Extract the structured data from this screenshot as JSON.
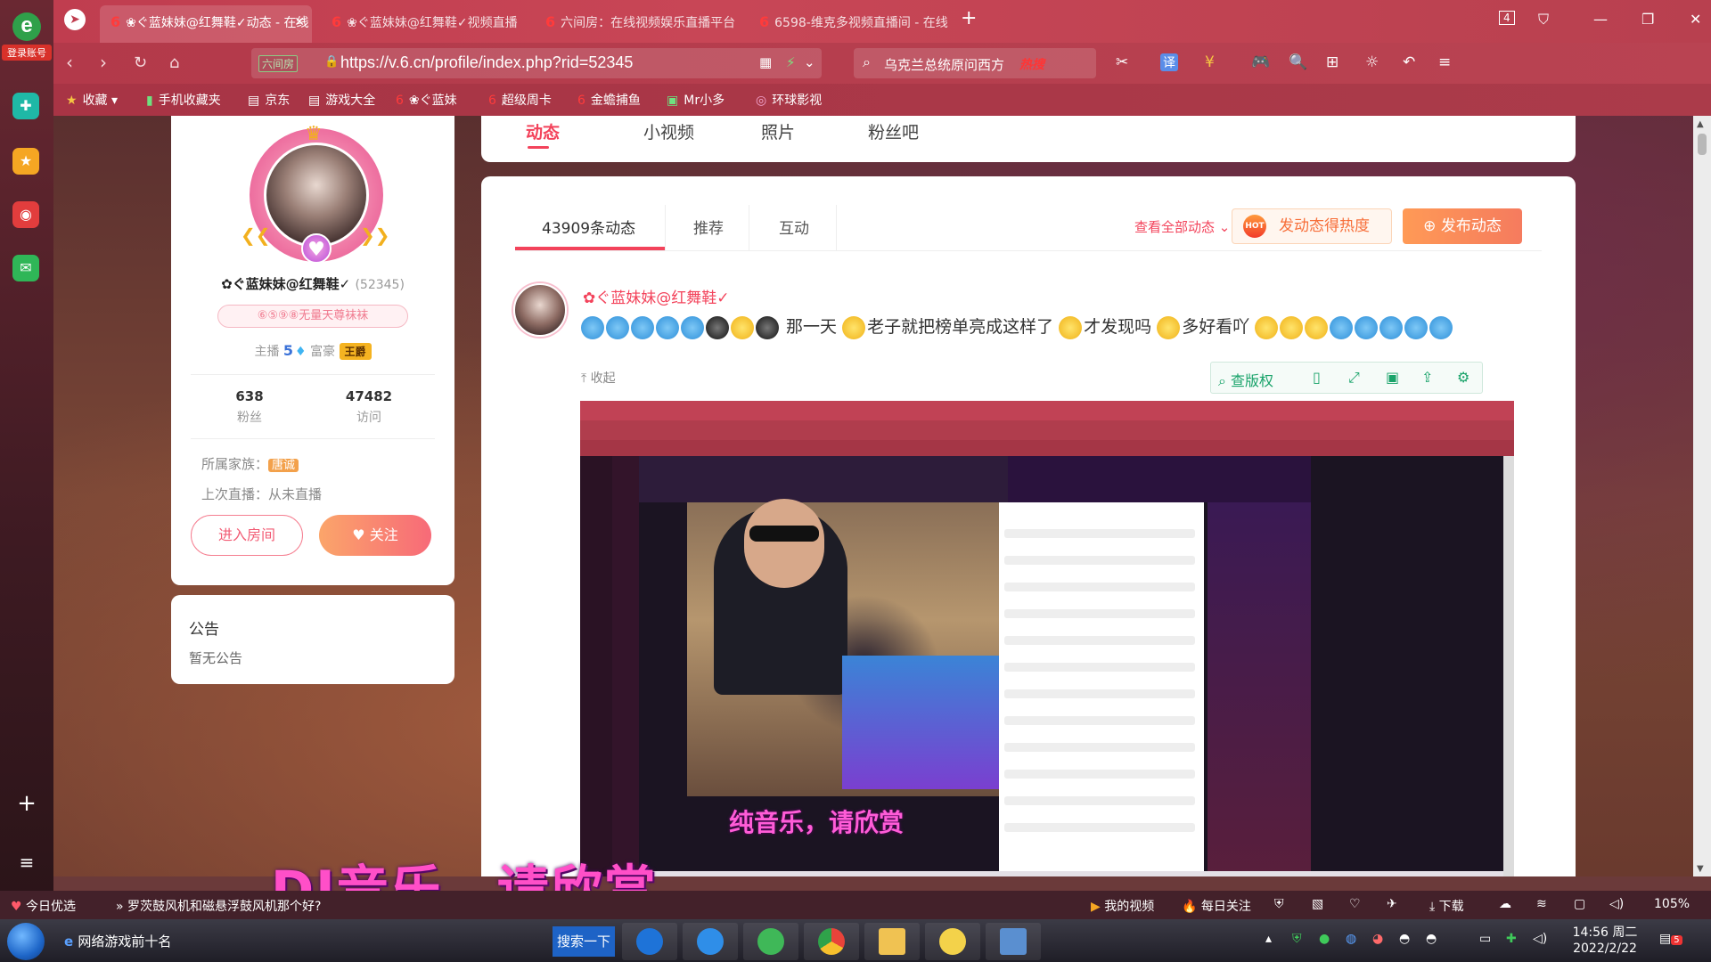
{
  "sidebar": {
    "login_label": "登录账号"
  },
  "tabs": [
    {
      "label": "❀ぐ蓝妹妹@红舞鞋✓动态 - 在线",
      "active": true
    },
    {
      "label": "❀ぐ蓝妹妹@红舞鞋✓视频直播"
    },
    {
      "label": "六间房：在线视频娱乐直播平台"
    },
    {
      "label": "6598-维克多视频直播间 - 在线"
    }
  ],
  "tab_count": "4",
  "address": {
    "cert": "六间房",
    "url": "https://v.6.cn/profile/index.php?rid=52345"
  },
  "search": {
    "query": "乌克兰总统原问西方",
    "hot": "热搜"
  },
  "bookmarks": [
    "收藏",
    "手机收藏夹",
    "京东",
    "游戏大全",
    "❀ぐ蓝妹",
    "超级周卡",
    "金蟾捕鱼",
    "Mr小多",
    "环球影视"
  ],
  "page_tabs": [
    "动态",
    "小视频",
    "照片",
    "粉丝吧"
  ],
  "profile": {
    "name": "✿ぐ蓝妹妹@红舞鞋✓",
    "id": "(52345)",
    "badge": "⑥⑤⑨⑧无量天尊袜袜",
    "anchor_label": "主播",
    "anchor_level": "5",
    "rich_label": "富豪",
    "rich_title": "王爵",
    "fans_count": "638",
    "fans_label": "粉丝",
    "visits_count": "47482",
    "visits_label": "访问",
    "family_label": "所属家族：",
    "family_name": "唐诚",
    "last_live": "上次直播：从未直播",
    "enter_room": "进入房间",
    "follow": "关注"
  },
  "notice": {
    "title": "公告",
    "content": "暂无公告"
  },
  "feed": {
    "tabs": [
      "43909条动态",
      "推荐",
      "互动"
    ],
    "view_all": "查看全部动态",
    "hot_badge": "HOT",
    "hot_button": "发动态得热度",
    "post_button": "发布动态",
    "post": {
      "author": "✿ぐ蓝妹妹@红舞鞋✓",
      "text_1": "那一天",
      "text_2": "老子就把榜单亮成这样了",
      "text_3": "才发现吗",
      "text_4": "多好看吖",
      "fold": "收起",
      "copyright": "查版权"
    }
  },
  "overlay": {
    "small": "纯音乐，请欣赏",
    "big": "DJ音乐，请欣赏"
  },
  "statusbar": {
    "left": "今日优选",
    "headline": "罗茨鼓风机和磁悬浮鼓风机那个好?",
    "my_video": "我的视频",
    "daily": "每日关注",
    "download": "下载",
    "zoom": "105%"
  },
  "taskbar": {
    "ie_label": "网络游戏前十名",
    "search": "搜索一下",
    "time": "14:56 周二",
    "date": "2022/2/22",
    "notif": "5"
  }
}
